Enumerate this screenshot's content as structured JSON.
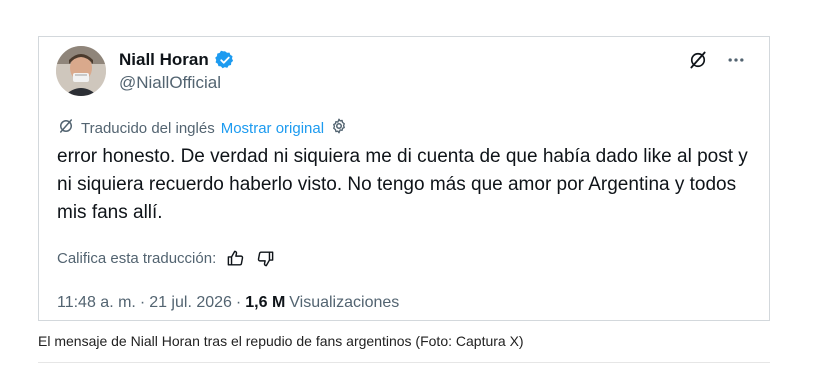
{
  "tweet": {
    "author_name": "Niall Horan",
    "author_handle": "@NiallOfficial",
    "translated_label": "Traducido del inglés",
    "show_original_label": "Mostrar original",
    "body": "error honesto. De verdad ni siquiera me di cuenta de que había dado like al post y ni siquiera recuerdo haberlo visto. No tengo más que amor por Argentina y todos mis fans allí.",
    "rate_label": "Califica esta traducción:",
    "time": "11:48 a. m.",
    "date": "21 jul. 2026",
    "views_count": "1,6 M",
    "views_label": "Visualizaciones",
    "separator": "·"
  },
  "caption": "El mensaje de Niall Horan tras el repudio de fans argentinos (Foto: Captura X)",
  "colors": {
    "text": "#0f1419",
    "muted": "#536471",
    "link": "#1d9bf0",
    "verified": "#1d9bf0",
    "border": "#d3d8dc"
  },
  "icons": [
    "verified-badge-icon",
    "grok-icon",
    "more-icon",
    "translate-icon",
    "settings-icon",
    "thumbs-up-icon",
    "thumbs-down-icon"
  ]
}
